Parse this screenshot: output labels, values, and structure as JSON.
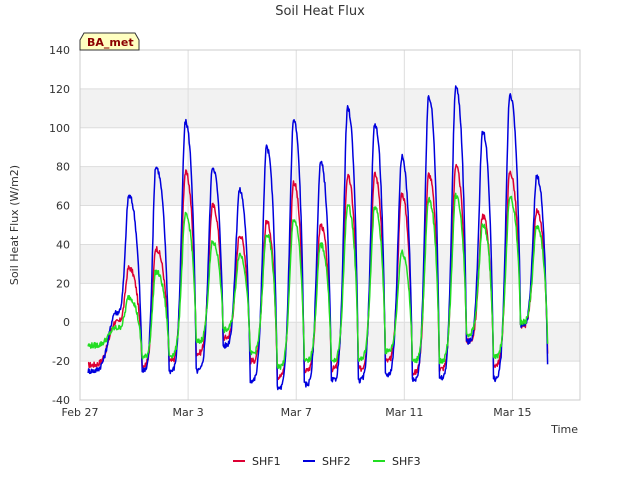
{
  "chart_data": {
    "type": "line",
    "title": "Soil Heat Flux",
    "xlabel": "Time",
    "ylabel": "Soil Heat Flux (W/m2)",
    "badge": "BA_met",
    "ylim": [
      -40,
      140
    ],
    "yticks": [
      -40,
      -20,
      0,
      20,
      40,
      60,
      80,
      100,
      120,
      140
    ],
    "xlim": [
      0,
      18.5
    ],
    "xticks": [
      {
        "label": "Feb 27",
        "day": 0
      },
      {
        "label": "Mar 3",
        "day": 4
      },
      {
        "label": "Mar 7",
        "day": 8
      },
      {
        "label": "Mar 11",
        "day": 12
      },
      {
        "label": "Mar 15",
        "day": 16
      }
    ],
    "x_unit": "days since Feb 27",
    "grid": true,
    "legend_position": "bottom",
    "series": [
      {
        "name": "SHF1",
        "color": "#dd0033",
        "peaks": [
          {
            "day": 1.8,
            "value": 28
          },
          {
            "day": 2.8,
            "value": 38
          },
          {
            "day": 3.9,
            "value": 77
          },
          {
            "day": 4.9,
            "value": 60
          },
          {
            "day": 5.9,
            "value": 45
          },
          {
            "day": 6.9,
            "value": 52
          },
          {
            "day": 7.9,
            "value": 72
          },
          {
            "day": 8.9,
            "value": 50
          },
          {
            "day": 9.9,
            "value": 75
          },
          {
            "day": 10.9,
            "value": 76
          },
          {
            "day": 11.9,
            "value": 66
          },
          {
            "day": 12.9,
            "value": 76
          },
          {
            "day": 13.9,
            "value": 80
          },
          {
            "day": 14.9,
            "value": 55
          },
          {
            "day": 15.9,
            "value": 77
          },
          {
            "day": 16.9,
            "value": 57
          }
        ],
        "troughs": [
          {
            "day": 0.3,
            "value": -22
          },
          {
            "day": 1.3,
            "value": 0
          },
          {
            "day": 2.3,
            "value": -22
          },
          {
            "day": 3.3,
            "value": -20
          },
          {
            "day": 4.3,
            "value": -16
          },
          {
            "day": 5.3,
            "value": -8
          },
          {
            "day": 6.3,
            "value": -20
          },
          {
            "day": 7.3,
            "value": -28
          },
          {
            "day": 8.3,
            "value": -25
          },
          {
            "day": 9.3,
            "value": -24
          },
          {
            "day": 10.3,
            "value": -24
          },
          {
            "day": 11.3,
            "value": -20
          },
          {
            "day": 12.3,
            "value": -26
          },
          {
            "day": 13.3,
            "value": -24
          },
          {
            "day": 14.3,
            "value": -10
          },
          {
            "day": 15.3,
            "value": -22
          },
          {
            "day": 16.3,
            "value": -2
          },
          {
            "day": 17.3,
            "value": -15
          }
        ]
      },
      {
        "name": "SHF2",
        "color": "#0000dd",
        "peaks": [
          {
            "day": 1.8,
            "value": 65
          },
          {
            "day": 2.8,
            "value": 80
          },
          {
            "day": 3.9,
            "value": 103
          },
          {
            "day": 4.9,
            "value": 80
          },
          {
            "day": 5.9,
            "value": 68
          },
          {
            "day": 6.9,
            "value": 90
          },
          {
            "day": 7.9,
            "value": 104
          },
          {
            "day": 8.9,
            "value": 82
          },
          {
            "day": 9.9,
            "value": 110
          },
          {
            "day": 10.9,
            "value": 102
          },
          {
            "day": 11.9,
            "value": 85
          },
          {
            "day": 12.9,
            "value": 116
          },
          {
            "day": 13.9,
            "value": 121
          },
          {
            "day": 14.9,
            "value": 98
          },
          {
            "day": 15.9,
            "value": 117
          },
          {
            "day": 16.9,
            "value": 75
          }
        ],
        "troughs": [
          {
            "day": 0.3,
            "value": -25
          },
          {
            "day": 1.3,
            "value": 5
          },
          {
            "day": 2.3,
            "value": -25
          },
          {
            "day": 3.3,
            "value": -25
          },
          {
            "day": 4.3,
            "value": -25
          },
          {
            "day": 5.3,
            "value": -12
          },
          {
            "day": 6.3,
            "value": -30
          },
          {
            "day": 7.3,
            "value": -34
          },
          {
            "day": 8.3,
            "value": -32
          },
          {
            "day": 9.3,
            "value": -30
          },
          {
            "day": 10.3,
            "value": -30
          },
          {
            "day": 11.3,
            "value": -27
          },
          {
            "day": 12.3,
            "value": -30
          },
          {
            "day": 13.3,
            "value": -29
          },
          {
            "day": 14.3,
            "value": -10
          },
          {
            "day": 15.3,
            "value": -29
          },
          {
            "day": 16.3,
            "value": -2
          },
          {
            "day": 17.3,
            "value": -22
          }
        ]
      },
      {
        "name": "SHF3",
        "color": "#22dd22",
        "peaks": [
          {
            "day": 1.8,
            "value": 13
          },
          {
            "day": 2.8,
            "value": 26
          },
          {
            "day": 3.9,
            "value": 55
          },
          {
            "day": 4.9,
            "value": 41
          },
          {
            "day": 5.9,
            "value": 35
          },
          {
            "day": 6.9,
            "value": 45
          },
          {
            "day": 7.9,
            "value": 53
          },
          {
            "day": 8.9,
            "value": 40
          },
          {
            "day": 9.9,
            "value": 60
          },
          {
            "day": 10.9,
            "value": 59
          },
          {
            "day": 11.9,
            "value": 36
          },
          {
            "day": 12.9,
            "value": 63
          },
          {
            "day": 13.9,
            "value": 65
          },
          {
            "day": 14.9,
            "value": 50
          },
          {
            "day": 15.9,
            "value": 64
          },
          {
            "day": 16.9,
            "value": 49
          }
        ],
        "troughs": [
          {
            "day": 0.3,
            "value": -12
          },
          {
            "day": 1.3,
            "value": -3
          },
          {
            "day": 2.3,
            "value": -18
          },
          {
            "day": 3.3,
            "value": -17
          },
          {
            "day": 4.3,
            "value": -10
          },
          {
            "day": 5.3,
            "value": -4
          },
          {
            "day": 6.3,
            "value": -16
          },
          {
            "day": 7.3,
            "value": -23
          },
          {
            "day": 8.3,
            "value": -20
          },
          {
            "day": 9.3,
            "value": -20
          },
          {
            "day": 10.3,
            "value": -19
          },
          {
            "day": 11.3,
            "value": -15
          },
          {
            "day": 12.3,
            "value": -20
          },
          {
            "day": 13.3,
            "value": -20
          },
          {
            "day": 14.3,
            "value": -6
          },
          {
            "day": 15.3,
            "value": -18
          },
          {
            "day": 16.3,
            "value": 0
          },
          {
            "day": 17.3,
            "value": -10
          }
        ]
      }
    ]
  }
}
